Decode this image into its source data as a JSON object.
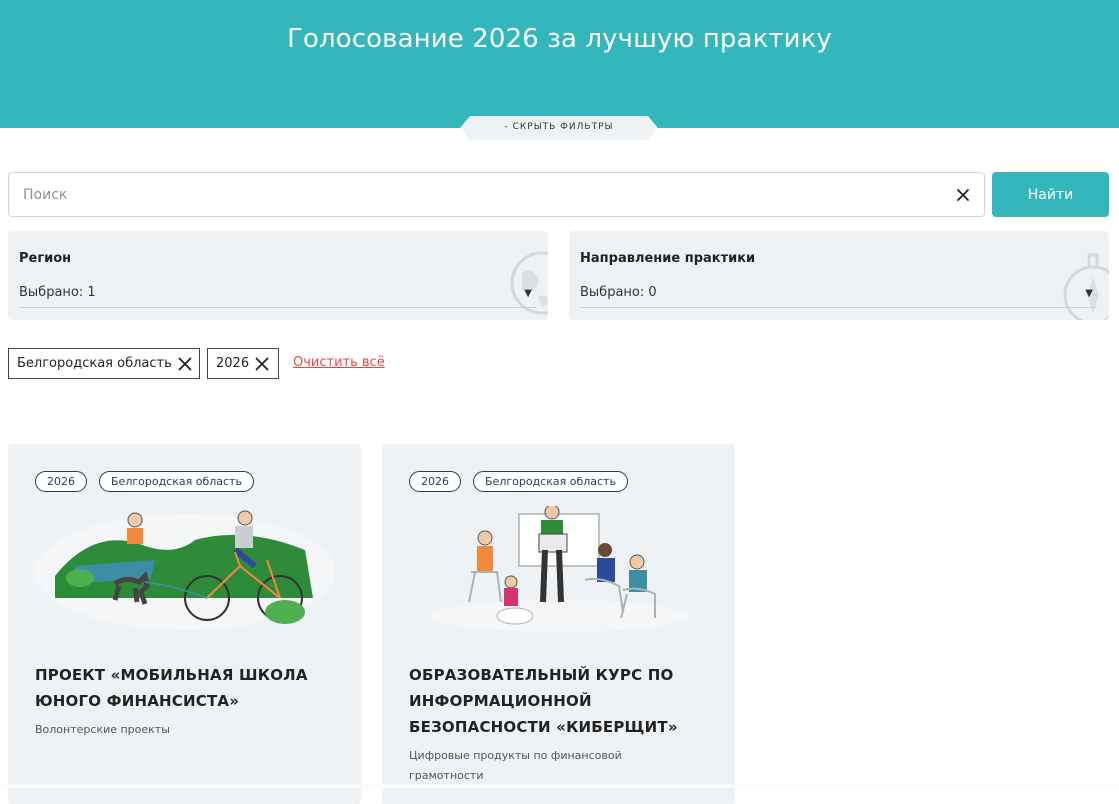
{
  "header": {
    "title": "Голосование 2026 за лучшую практику"
  },
  "filters_toggle": {
    "label": "- скрыть фильтры"
  },
  "search": {
    "placeholder": "Поиск",
    "value": "",
    "button_label": "Найти"
  },
  "filters": {
    "region": {
      "label": "Регион",
      "selected": "Выбрано: 1"
    },
    "direction": {
      "label": "Направление практики",
      "selected": "Выбрано: 0"
    }
  },
  "active_filters": {
    "chips": [
      "Белгородская область",
      "2026"
    ],
    "clear_all_label": "Очистить всё"
  },
  "cards": [
    {
      "year": "2026",
      "region": "Белгородская область",
      "title_lines": [
        "ПРОЕКТ «МОБИЛЬНАЯ ШКОЛА",
        "ЮНОГО ФИНАНСИСТА»"
      ],
      "category_lines": [
        "Волонтерские проекты"
      ]
    },
    {
      "year": "2026",
      "region": "Белгородская область",
      "title_lines": [
        "ОБРАЗОВАТЕЛЬНЫЙ КУРС ПО",
        "ИНФОРМАЦИОННОЙ",
        "БЕЗОПАСНОСТИ «КИБЕРЩИТ»"
      ],
      "category_lines": [
        "Цифровые продукты по финансовой",
        "грамотности"
      ]
    }
  ],
  "colors": {
    "accent": "#34b6bd",
    "danger": "#e24a4a",
    "card_bg": "#eef2f5",
    "badge": "#1f3f63"
  },
  "icons": [
    "close-icon",
    "chevron-down-icon",
    "globe-icon",
    "compass-icon"
  ]
}
